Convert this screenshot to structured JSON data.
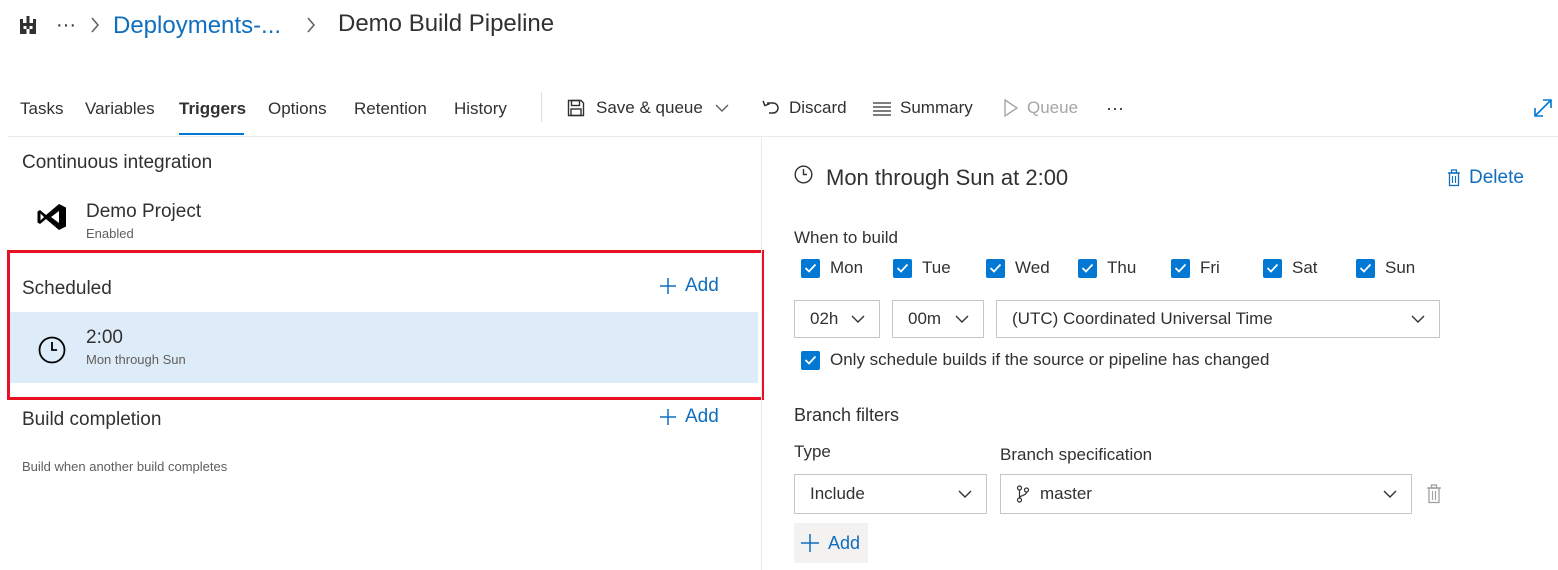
{
  "breadcrumb": {
    "project_icon": "castle-icon",
    "more_label": "···",
    "parent": "Deployments-...",
    "current": "Demo Build Pipeline"
  },
  "tabs": [
    {
      "label": "Tasks",
      "active": false
    },
    {
      "label": "Variables",
      "active": false
    },
    {
      "label": "Triggers",
      "active": true
    },
    {
      "label": "Options",
      "active": false
    },
    {
      "label": "Retention",
      "active": false
    },
    {
      "label": "History",
      "active": false
    }
  ],
  "toolbar": {
    "save_queue": "Save & queue",
    "discard": "Discard",
    "summary": "Summary",
    "queue": "Queue",
    "more": "···"
  },
  "left": {
    "ci": {
      "title": "Continuous integration",
      "item_name": "Demo Project",
      "item_status": "Enabled"
    },
    "scheduled": {
      "title": "Scheduled",
      "add": "Add",
      "item_time": "2:00",
      "item_days": "Mon through Sun"
    },
    "build_completion": {
      "title": "Build completion",
      "add": "Add",
      "desc": "Build when another build completes"
    }
  },
  "right": {
    "header": "Mon through Sun at 2:00",
    "delete": "Delete",
    "when_to_build": "When to build",
    "days": [
      {
        "label": "Mon",
        "checked": true
      },
      {
        "label": "Tue",
        "checked": true
      },
      {
        "label": "Wed",
        "checked": true
      },
      {
        "label": "Thu",
        "checked": true
      },
      {
        "label": "Fri",
        "checked": true
      },
      {
        "label": "Sat",
        "checked": true
      },
      {
        "label": "Sun",
        "checked": true
      }
    ],
    "hour": "02h",
    "minute": "00m",
    "timezone": "(UTC) Coordinated Universal Time",
    "only_changed": "Only schedule builds if the source or pipeline has changed",
    "branch_filters": "Branch filters",
    "type_label": "Type",
    "type_value": "Include",
    "branch_spec_label": "Branch specification",
    "branch_value": "master",
    "add": "Add"
  },
  "colors": {
    "accent": "#0078d4",
    "link": "#106ebe",
    "selected_row": "#deecf9",
    "highlight_border": "#e81123"
  }
}
